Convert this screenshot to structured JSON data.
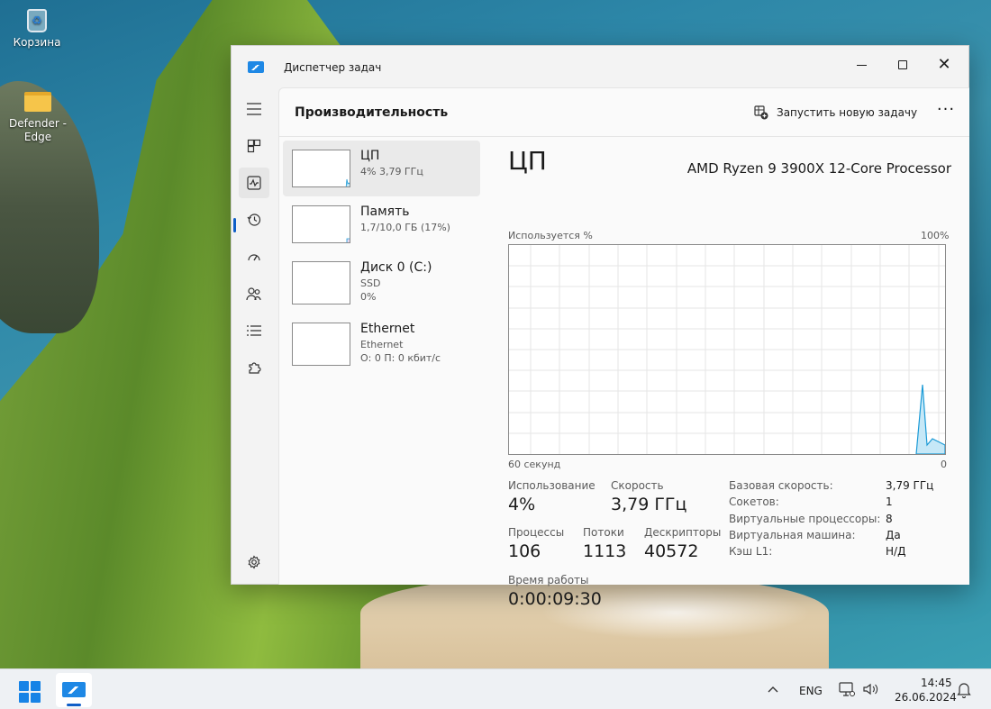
{
  "desktop": {
    "icons": [
      {
        "label": "Корзина"
      },
      {
        "label": "Defender - Edge"
      }
    ]
  },
  "window": {
    "title": "Диспетчер задач",
    "header": {
      "page_title": "Производительность",
      "run_task_label": "Запустить новую задачу",
      "more_label": "···"
    },
    "rail": [
      "menu-icon",
      "processes-icon",
      "performance-icon",
      "app-history-icon",
      "startup-icon",
      "users-icon",
      "details-icon",
      "services-icon",
      "settings-icon"
    ],
    "resources": [
      {
        "name": "ЦП",
        "sub1": "4% 3,79 ГГц",
        "sub2": ""
      },
      {
        "name": "Память",
        "sub1": "1,7/10,0 ГБ (17%)",
        "sub2": ""
      },
      {
        "name": "Диск 0 (C:)",
        "sub1": "SSD",
        "sub2": "0%"
      },
      {
        "name": "Ethernet",
        "sub1": "Ethernet",
        "sub2": "О: 0 П: 0 кбит/с"
      }
    ],
    "detail": {
      "title": "ЦП",
      "model": "AMD Ryzen 9 3900X 12-Core Processor",
      "graph_label_left": "Используется %",
      "graph_label_right": "100%",
      "graph_bottom_left": "60 секунд",
      "graph_bottom_right": "0",
      "stats": {
        "usage_label": "Использование",
        "usage_value": "4%",
        "speed_label": "Скорость",
        "speed_value": "3,79 ГГц",
        "processes_label": "Процессы",
        "processes_value": "106",
        "threads_label": "Потоки",
        "threads_value": "1113",
        "handles_label": "Дескрипторы",
        "handles_value": "40572",
        "uptime_label": "Время работы",
        "uptime_value": "0:00:09:30"
      },
      "specs": [
        {
          "key": "Базовая скорость:",
          "value": "3,79 ГГц"
        },
        {
          "key": "Сокетов:",
          "value": "1"
        },
        {
          "key": "Виртуальные процессоры:",
          "value": "8"
        },
        {
          "key": "Виртуальная машина:",
          "value": "Да"
        },
        {
          "key": "Кэш L1:",
          "value": "Н/Д"
        }
      ]
    }
  },
  "taskbar": {
    "language": "ENG",
    "time": "14:45",
    "date": "26.06.2024"
  },
  "colors": {
    "accent": "#0f5ec7",
    "graph_line": "#1a9ad6",
    "graph_fill": "#c6e8f7"
  }
}
